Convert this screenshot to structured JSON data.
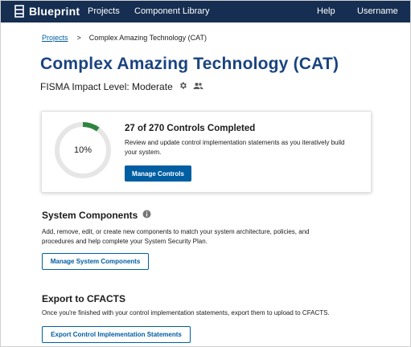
{
  "nav": {
    "brand": "Blueprint",
    "links": {
      "projects": "Projects",
      "component_library": "Component Library",
      "help": "Help",
      "username": "Username"
    }
  },
  "breadcrumb": {
    "projects": "Projects",
    "separator": ">",
    "current": "Complex Amazing Technology (CAT)"
  },
  "project": {
    "title": "Complex Amazing Technology (CAT)",
    "fisma": "FISMA Impact Level: Moderate"
  },
  "progress": {
    "percent_label": "10%",
    "completed": 27,
    "total": 270,
    "fraction": 0.1,
    "title": "27 of 270 Controls Completed",
    "description": "Review and update control implementation statements as you iteratively build your system.",
    "button": "Manage Controls"
  },
  "system_components": {
    "title": "System Components",
    "description": "Add, remove, edit, or create new components to match your system architecture, policies, and procedures and help complete your System Security Plan.",
    "button": "Manage System Components"
  },
  "export": {
    "title": "Export to CFACTS",
    "description": "Once you're finished with your control implementation statements, export them to upload to CFACTS.",
    "button": "Export Control Implementation Statements"
  },
  "colors": {
    "nav_bg": "#162e51",
    "title": "#1a4480",
    "primary": "#005ea2",
    "progress": "#2e8540",
    "track": "#e6e6e6"
  },
  "icons": {
    "brand": "blueprint-logo-icon",
    "settings": "gear-icon",
    "users": "people-icon",
    "info": "info-icon"
  }
}
